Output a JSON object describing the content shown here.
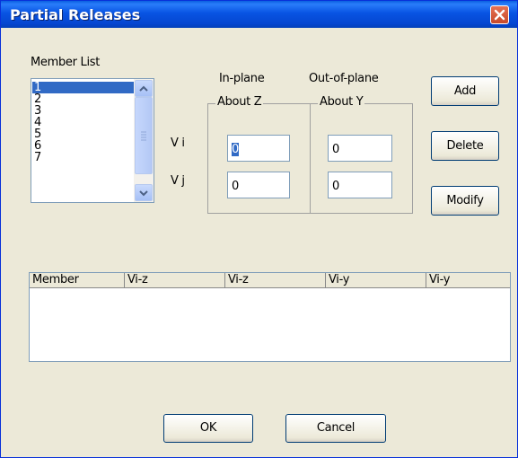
{
  "window": {
    "title": "Partial Releases"
  },
  "member_list": {
    "label": "Member List",
    "items": [
      "1",
      "2",
      "3",
      "4",
      "5",
      "6",
      "7"
    ],
    "selected": "1"
  },
  "releases": {
    "in_plane_label": "In-plane",
    "out_of_plane_label": "Out-of-plane",
    "about_z_label": "About Z",
    "about_y_label": "About Y",
    "vi_label": "V i",
    "vj_label": "V j",
    "vi_about_z": "0",
    "vj_about_z": "0",
    "vi_about_y": "0",
    "vj_about_y": "0"
  },
  "actions": {
    "add": "Add",
    "delete": "Delete",
    "modify": "Modify"
  },
  "table": {
    "columns": [
      "Member",
      "Vi-z",
      "Vi-z",
      "Vi-y",
      "Vi-y"
    ],
    "rows": []
  },
  "footer": {
    "ok": "OK",
    "cancel": "Cancel"
  }
}
